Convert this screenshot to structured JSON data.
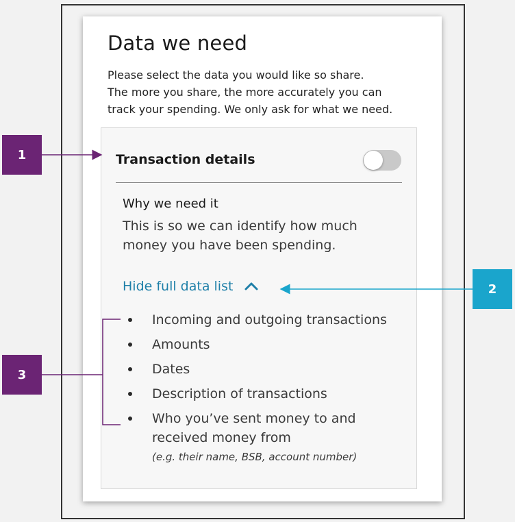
{
  "card": {
    "title": "Data we need",
    "intro_lines": [
      "Please select the data you would like so share.",
      "The more you share, the more accurately you can",
      "track your spending. We only ask for what we need."
    ]
  },
  "panel": {
    "title": "Transaction details",
    "toggle_on": false,
    "why_title": "Why we need it",
    "why_lines": [
      "This is so we can identify how much",
      "money you have been spending."
    ],
    "hide_link": "Hide full data list",
    "items": [
      {
        "lines": [
          "Incoming and outgoing transactions"
        ]
      },
      {
        "lines": [
          "Amounts"
        ]
      },
      {
        "lines": [
          "Dates"
        ]
      },
      {
        "lines": [
          "Description of transactions"
        ]
      },
      {
        "lines": [
          "Who you’ve sent money to and",
          "received money from"
        ],
        "note": "(e.g. their name, BSB, account number)"
      }
    ]
  },
  "callouts": {
    "c1": "1",
    "c2": "2",
    "c3": "3"
  },
  "colors": {
    "callout_purple": "#6b2474",
    "callout_cyan": "#1aa5cc",
    "link_blue": "#1e7fa8"
  }
}
